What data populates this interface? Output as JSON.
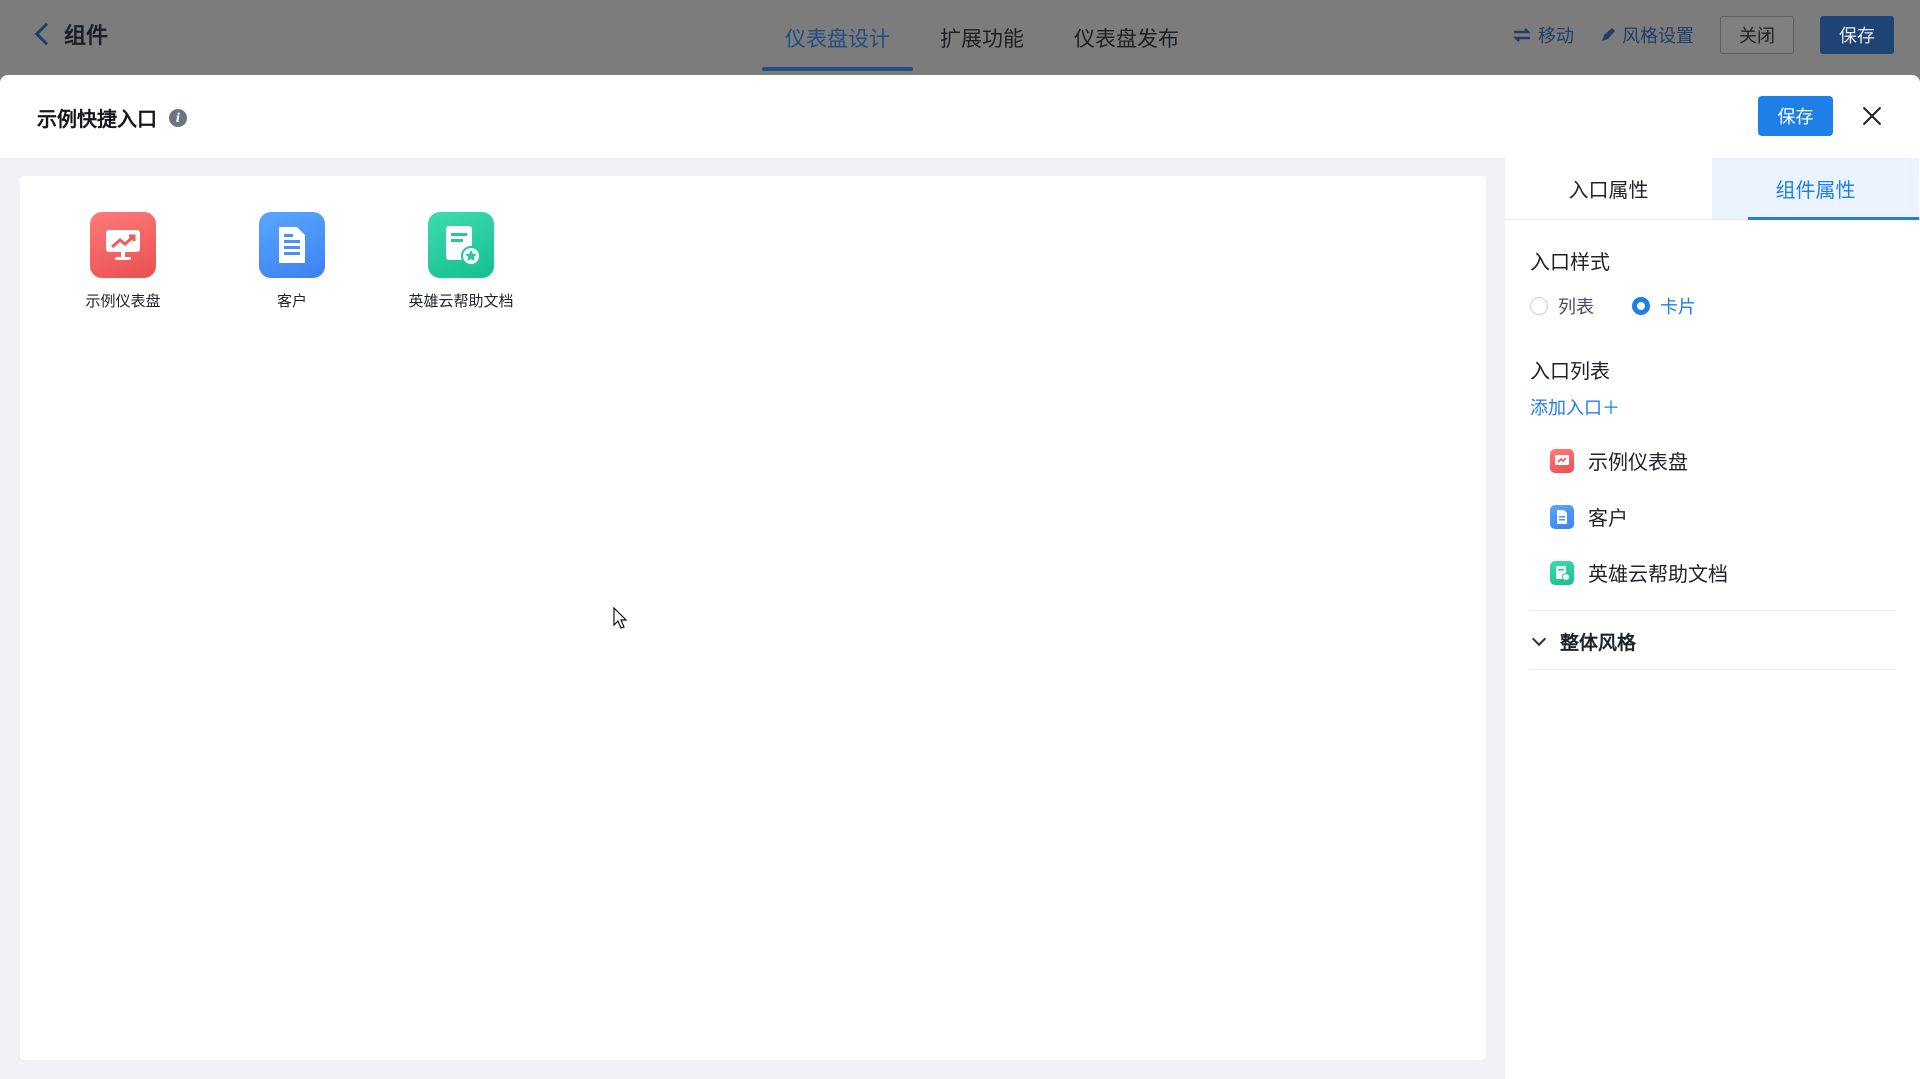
{
  "topbar": {
    "back_label": "组件",
    "tabs": [
      {
        "label": "仪表盘设计",
        "active": true
      },
      {
        "label": "扩展功能",
        "active": false
      },
      {
        "label": "仪表盘发布",
        "active": false
      }
    ],
    "move_label": "移动",
    "style_label": "风格设置",
    "close_label": "关闭",
    "save_label": "保存"
  },
  "modal": {
    "title": "示例快捷入口",
    "save_label": "保存",
    "tiles": [
      {
        "label": "示例仪表盘",
        "icon": "dashboard-chart-icon",
        "color": "#ef5b5b"
      },
      {
        "label": "客户",
        "icon": "document-icon",
        "color": "#4a90f5"
      },
      {
        "label": "英雄云帮助文档",
        "icon": "starred-document-icon",
        "color": "#22c99a"
      }
    ]
  },
  "panel": {
    "tabs": [
      {
        "label": "入口属性",
        "active": false
      },
      {
        "label": "组件属性",
        "active": true
      }
    ],
    "entry_style": {
      "title": "入口样式",
      "options": [
        {
          "label": "列表",
          "selected": false
        },
        {
          "label": "卡片",
          "selected": true
        }
      ]
    },
    "entry_list": {
      "title": "入口列表",
      "add_label": "添加入口＋",
      "items": [
        {
          "label": "示例仪表盘",
          "icon": "dashboard-chart-icon"
        },
        {
          "label": "客户",
          "icon": "document-icon"
        },
        {
          "label": "英雄云帮助文档",
          "icon": "starred-document-icon"
        }
      ]
    },
    "overall_style_label": "整体风格"
  },
  "colors": {
    "primary": "#1e7fe6",
    "red": "#ef5b5b",
    "blue": "#4a90f5",
    "green": "#22c99a"
  }
}
